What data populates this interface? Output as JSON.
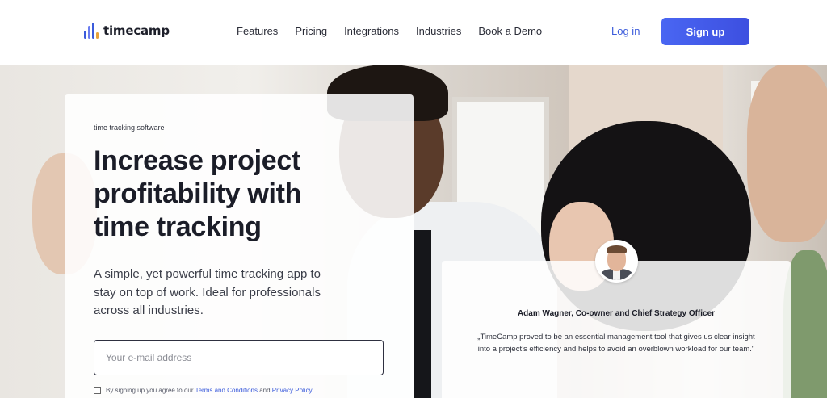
{
  "brand": {
    "name": "timecamp",
    "mark_colors": [
      "#3b5bdb",
      "#6a7cf0",
      "#e6a23c"
    ]
  },
  "nav": {
    "items": [
      "Features",
      "Pricing",
      "Integrations",
      "Industries",
      "Book a Demo"
    ],
    "login_label": "Log in",
    "signup_label": "Sign up"
  },
  "hero": {
    "eyebrow": "time tracking software",
    "headline": "Increase project profitability with time tracking",
    "subtext": "A simple, yet powerful time tracking app to stay on top of work. Ideal for professionals across all industries.",
    "email_placeholder": "Your e-mail address",
    "email_value": "",
    "consent": {
      "prefix": "By signing up you agree to our",
      "terms_label": "Terms and Conditions",
      "and": "and",
      "privacy_label": "Privacy Policy",
      "suffix": "."
    }
  },
  "testimonial": {
    "author": "Adam Wagner, Co-owner and Chief Strategy Officer",
    "quote": "„TimeCamp proved to be an essential management tool that gives us clear insight into a project’s efficiency and helps to avoid an overblown workload for our team.\""
  },
  "colors": {
    "accent": "#3b5bdb",
    "signup_bg": "#4966f2",
    "headline": "#1b1d28"
  }
}
